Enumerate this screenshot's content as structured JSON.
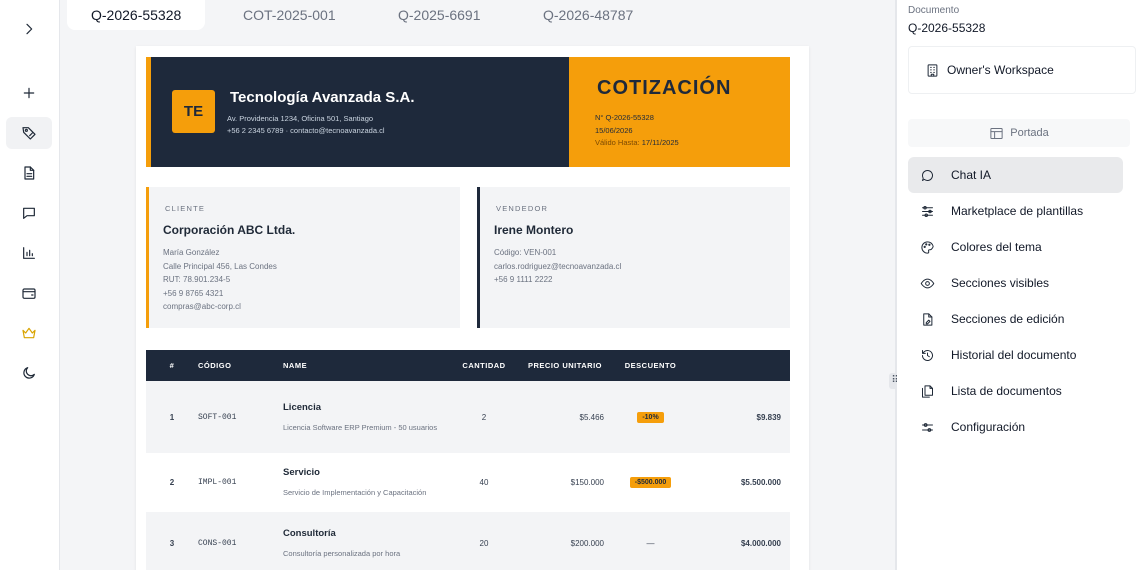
{
  "tabs": [
    {
      "label": "Q-2026-55328"
    },
    {
      "label": "COT-2025-001"
    },
    {
      "label": "Q-2025-6691"
    },
    {
      "label": "Q-2026-48787"
    }
  ],
  "rail_icons": [
    "chevron-right-icon",
    "plus-icon",
    "tag-icon",
    "document-icon",
    "chat-icon",
    "bar-chart-icon",
    "wallet-icon",
    "crown-icon",
    "moon-icon"
  ],
  "doc": {
    "logo": "TE",
    "company": "Tecnología Avanzada S.A.",
    "address": "Av. Providencia 1234, Oficina 501, Santiago",
    "contact": "+56 2 2345 6789 · contacto@tecnoavanzada.cl",
    "type": "COTIZACIÓN",
    "number": "N° Q-2026-55328",
    "date": "15/06/2026",
    "valid_label": "Válido Hasta:",
    "valid_date": "17/11/2025",
    "client": {
      "kicker": "CLIENTE",
      "name": "Corporación ABC Ltda.",
      "lines": [
        "María González",
        "Calle Principal 456, Las Condes",
        "RUT: 78.901.234-5",
        "+56 9 8765 4321",
        "compras@abc-corp.cl"
      ]
    },
    "seller": {
      "kicker": "VENDEDOR",
      "name": "Irene Montero",
      "lines": [
        "Código: VEN-001",
        "carlos.rodriguez@tecnoavanzada.cl",
        "+56 9 1111 2222"
      ]
    },
    "columns": [
      "#",
      "CÓDIGO",
      "NAME",
      "CANTIDAD",
      "PRECIO UNITARIO",
      "DESCUENTO",
      ""
    ],
    "items": [
      {
        "n": "1",
        "code": "SOFT-001",
        "title": "Licencia",
        "desc": "Licencia Software ERP Premium - 50 usuarios",
        "qty": "2",
        "price": "$5.466",
        "discount": "-10%",
        "total": "$9.839"
      },
      {
        "n": "2",
        "code": "IMPL-001",
        "title": "Servicio",
        "desc": "Servicio de Implementación y Capacitación",
        "qty": "40",
        "price": "$150.000",
        "discount": "-$500.000",
        "total": "$5.500.000"
      },
      {
        "n": "3",
        "code": "CONS-001",
        "title": "Consultoría",
        "desc": "Consultoría personalizada por hora",
        "qty": "20",
        "price": "$200.000",
        "discount": "—",
        "total": "$4.000.000"
      }
    ]
  },
  "panel": {
    "doc_label": "Documento",
    "doc_value": "Q-2026-55328",
    "workspace": "Owner's Workspace",
    "portada": "Portada",
    "menu": [
      {
        "label": "Chat IA",
        "icon": "chat-icon"
      },
      {
        "label": "Marketplace de plantillas",
        "icon": "sliders-icon"
      },
      {
        "label": "Colores del tema",
        "icon": "palette-icon"
      },
      {
        "label": "Secciones visibles",
        "icon": "eye-icon"
      },
      {
        "label": "Secciones de edición",
        "icon": "file-edit-icon"
      },
      {
        "label": "Historial del documento",
        "icon": "history-icon"
      },
      {
        "label": "Lista de documentos",
        "icon": "files-icon"
      },
      {
        "label": "Configuración",
        "icon": "settings-sliders-icon"
      }
    ]
  },
  "colors": {
    "accent": "#f59e0b",
    "navy": "#1e293b"
  }
}
